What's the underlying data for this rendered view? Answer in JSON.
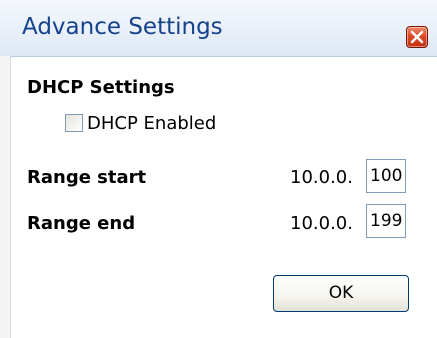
{
  "window": {
    "title": "Advance Settings"
  },
  "dhcp": {
    "section_title": "DHCP Settings",
    "enabled_label": "DHCP Enabled",
    "enabled_checked": false
  },
  "range_start": {
    "label": "Range start",
    "prefix": "10.0.0.",
    "value": "100"
  },
  "range_end": {
    "label": "Range end",
    "prefix": "10.0.0.",
    "value": "199"
  },
  "buttons": {
    "ok_label": "OK"
  },
  "icons": {
    "close": "close-icon"
  },
  "colors": {
    "title_text": "#15428b",
    "close_button": "#dd4a28",
    "input_border": "#7f9db9"
  }
}
